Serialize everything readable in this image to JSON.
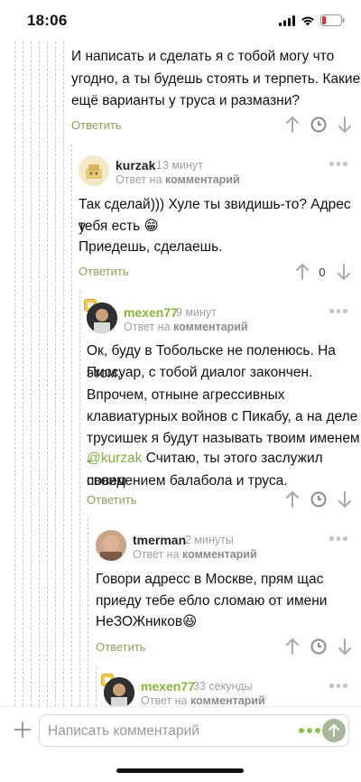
{
  "status_bar": {
    "time": "18:06"
  },
  "comments": [
    {
      "text_lines": [
        "И написать и сделать я с тобой могу что",
        "угодно, а ты будешь стоять и терпеть. Какие",
        "ещё варианты у труса и размазни?"
      ],
      "reply_label": "Ответить"
    },
    {
      "author": "kurzak",
      "time": "13 минут",
      "reply_to_prefix": "Ответ на",
      "reply_to_link": "комментарий",
      "text_lines": [
        "Так сделай))) Хуле ты звидишь-то? Адрес у",
        "тебя есть 😁",
        "Приедешь, сделаешь."
      ],
      "reply_label": "Ответить",
      "votes": "0"
    },
    {
      "author": "mexen77",
      "time": "9 минут",
      "reply_to_prefix": "Ответ на",
      "reply_to_link": "комментарий",
      "text_lines": [
        "Ок, буду в Тобольске не поленюсь. На этом,",
        "Писсуар, с тобой диалог закончен.",
        "Впрочем, отныне агрессивных",
        "клавиатурных войнов с Пикабу,  а на деле",
        "трусишек я будут называть твоим именем -"
      ],
      "mention": "@kurzak",
      "text_after_mention": " Считаю, ты этого заслужил своим",
      "text_last": "поведением балабола и труса.",
      "reply_label": "Ответить"
    },
    {
      "author": "tmerman",
      "time": "2 минуты",
      "reply_to_prefix": "Ответ на",
      "reply_to_link": "комментарий",
      "text_lines": [
        "Говори адресс в Москве, прям щас",
        "приеду тебе ебло сломаю от имени",
        "НеЗОЖников😆"
      ],
      "reply_label": "Ответить"
    },
    {
      "author": "mexen77",
      "time": "33 секунды",
      "reply_to_prefix": "Ответ на",
      "reply_to_link": "комментарий"
    }
  ],
  "composer": {
    "placeholder": "Написать комментарий"
  },
  "colors": {
    "accent_green": "#8ab43a",
    "reply_link": "#8da15b"
  }
}
